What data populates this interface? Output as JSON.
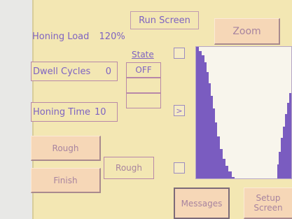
{
  "screen_title": "Run Screen",
  "zoom_label": "Zoom",
  "honing_load": {
    "label": "Honing Load",
    "value": "120%"
  },
  "dwell_cycles": {
    "label": "Dwell Cycles",
    "value": "0"
  },
  "honing_time": {
    "label": "Honing Time",
    "value": "10"
  },
  "state": {
    "header": "State",
    "values": [
      "OFF",
      "",
      ""
    ]
  },
  "arrow_button": ">",
  "rough_button": "Rough",
  "finish_button": "Finish",
  "mode_display": "Rough",
  "messages_button": "Messages",
  "setup_button": "Setup\nScreen",
  "colors": {
    "background": "#f3e7b3",
    "accent": "#7a5cc0",
    "button": "#f6d7b7"
  }
}
